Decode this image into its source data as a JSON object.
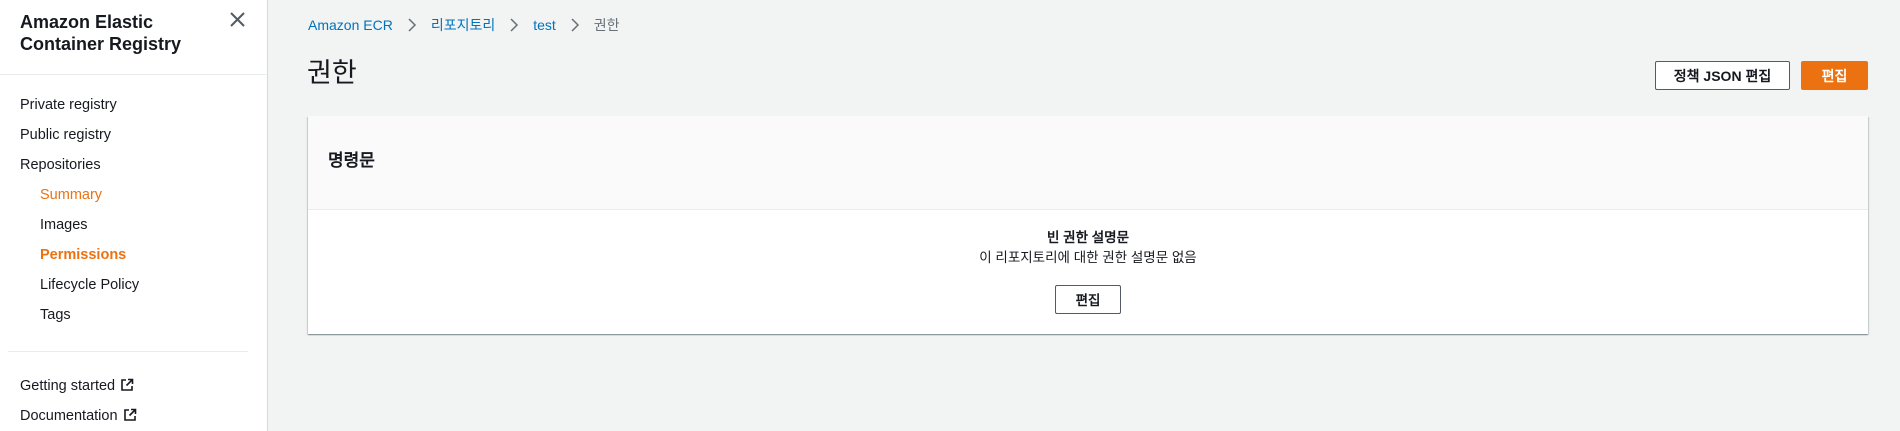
{
  "sidebar": {
    "title": "Amazon Elastic Container Registry",
    "items": [
      {
        "label": "Private registry"
      },
      {
        "label": "Public registry"
      },
      {
        "label": "Repositories"
      },
      {
        "label": "Summary"
      },
      {
        "label": "Images"
      },
      {
        "label": "Permissions"
      },
      {
        "label": "Lifecycle Policy"
      },
      {
        "label": "Tags"
      }
    ],
    "footer_links": [
      {
        "label": "Getting started"
      },
      {
        "label": "Documentation"
      }
    ]
  },
  "breadcrumb": {
    "items": [
      "Amazon ECR",
      "리포지토리",
      "test",
      "권한"
    ]
  },
  "page": {
    "title": "권한"
  },
  "header_actions": {
    "edit_policy_json": "정책 JSON 편집",
    "edit": "편집"
  },
  "statements_panel": {
    "title": "명령문",
    "empty_title": "빈 권한 설명문",
    "empty_description": "이 리포지토리에 대한 권한 설명문 없음",
    "edit_button": "편집"
  },
  "colors": {
    "accent": "#ec7211",
    "link": "#0073bb",
    "background": "#f2f3f3"
  }
}
